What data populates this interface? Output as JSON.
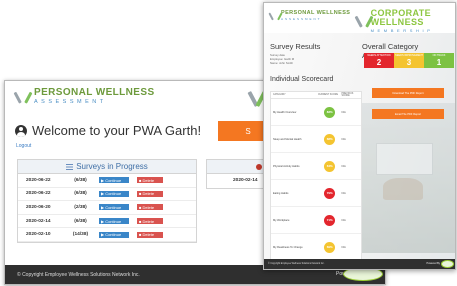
{
  "back_window": {
    "logo": {
      "line1": "PERSONAL WELLNESS",
      "line2": "ASSESSMENT"
    },
    "welcome_text": "Welcome to your PWA Garth!",
    "logout": "Logout",
    "orange_button_fragment": "S",
    "panel_title": "Surveys in Progress",
    "surveys": [
      {
        "date": "2020-06-22",
        "progress": "(6/38)",
        "continue": "Continue",
        "delete": "Delete"
      },
      {
        "date": "2020-06-22",
        "progress": "(6/38)",
        "continue": "Continue",
        "delete": "Delete"
      },
      {
        "date": "2020-06-20",
        "progress": "(2/38)",
        "continue": "Continue",
        "delete": "Delete"
      },
      {
        "date": "2020-02-14",
        "progress": "(6/38)",
        "continue": "Continue",
        "delete": "Delete"
      },
      {
        "date": "2020-02-10",
        "progress": "(14/38)",
        "continue": "Continue",
        "delete": "Delete"
      }
    ],
    "second_panel_date": "2020-02-14",
    "footer": "© Copyright Employee Wellness Solutions Network Inc.",
    "powered_by": "Powered By"
  },
  "front_window": {
    "logo_left": {
      "line1": "PERSONAL WELLNESS",
      "line2": "ASSESSMENT"
    },
    "logo_right": {
      "line1": "CORPORATE WELLNESS",
      "line2": "MEMBERSHIP"
    },
    "survey_results_title": "Survey Results",
    "survey_results_lines": [
      "Survey date",
      "Employee: Garth M",
      "Name: John Smith"
    ],
    "oca_title": "Overall Category Assessment",
    "oca_boxes": [
      {
        "label": "NEEDS ATTENTION",
        "value": "2",
        "color": "#e3262d"
      },
      {
        "label": "NEEDS IMPROVEMENT",
        "value": "3",
        "color": "#f4c430"
      },
      {
        "label": "ON TRACK",
        "value": "1",
        "color": "#7cc242"
      }
    ],
    "individual_title": "Individual Scorecard",
    "table_headers": [
      "CATEGORY",
      "CURRENT SCORE",
      "PREVIOUS SCORE"
    ],
    "scorecard": [
      {
        "category": "My Health Overview",
        "score": "83%",
        "previous": "N/A",
        "color": "#7cc242"
      },
      {
        "category": "Sleep and Mental Health",
        "score": "68%",
        "previous": "N/A",
        "color": "#f4c430"
      },
      {
        "category": "Physical Activity Habits",
        "score": "64%",
        "previous": "N/A",
        "color": "#f4c430"
      },
      {
        "category": "Eating Habits",
        "score": "79%",
        "previous": "N/A",
        "color": "#e3262d"
      },
      {
        "category": "My Workplace",
        "score": "71%",
        "previous": "N/A",
        "color": "#e3262d"
      },
      {
        "category": "My Readiness To Change",
        "score": "69%",
        "previous": "N/A",
        "color": "#f4c430"
      }
    ],
    "button_download": "Download The PDF Report",
    "button_email": "Email The PDF Report",
    "footer": "© Copyright Employee Wellness Solutions Network Inc.",
    "powered_by": "Powered By"
  }
}
